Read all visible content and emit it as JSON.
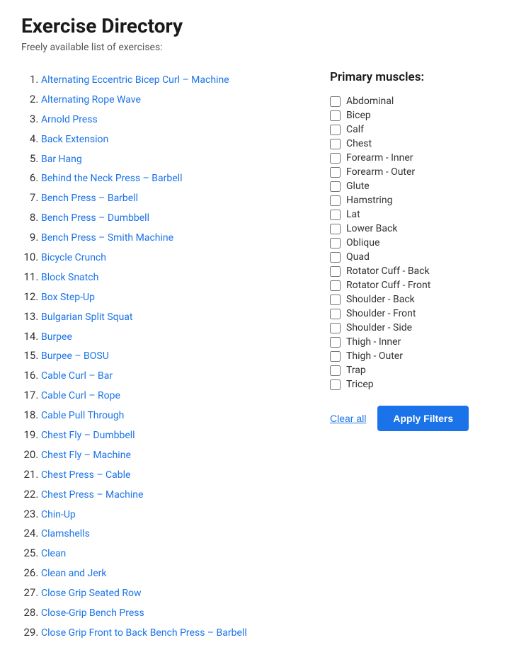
{
  "page": {
    "title": "Exercise Directory",
    "subtitle": "Freely available list of exercises:"
  },
  "exercises": [
    {
      "id": 1,
      "label": "Alternating Eccentric Bicep Curl – Machine"
    },
    {
      "id": 2,
      "label": "Alternating Rope Wave"
    },
    {
      "id": 3,
      "label": "Arnold Press"
    },
    {
      "id": 4,
      "label": "Back Extension"
    },
    {
      "id": 5,
      "label": "Bar Hang"
    },
    {
      "id": 6,
      "label": "Behind the Neck Press – Barbell"
    },
    {
      "id": 7,
      "label": "Bench Press – Barbell"
    },
    {
      "id": 8,
      "label": "Bench Press – Dumbbell"
    },
    {
      "id": 9,
      "label": "Bench Press – Smith Machine"
    },
    {
      "id": 10,
      "label": "Bicycle Crunch"
    },
    {
      "id": 11,
      "label": "Block Snatch"
    },
    {
      "id": 12,
      "label": "Box Step-Up"
    },
    {
      "id": 13,
      "label": "Bulgarian Split Squat"
    },
    {
      "id": 14,
      "label": "Burpee"
    },
    {
      "id": 15,
      "label": "Burpee – BOSU"
    },
    {
      "id": 16,
      "label": "Cable Curl – Bar"
    },
    {
      "id": 17,
      "label": "Cable Curl – Rope"
    },
    {
      "id": 18,
      "label": "Cable Pull Through"
    },
    {
      "id": 19,
      "label": "Chest Fly – Dumbbell"
    },
    {
      "id": 20,
      "label": "Chest Fly – Machine"
    },
    {
      "id": 21,
      "label": "Chest Press – Cable"
    },
    {
      "id": 22,
      "label": "Chest Press – Machine"
    },
    {
      "id": 23,
      "label": "Chin-Up"
    },
    {
      "id": 24,
      "label": "Clamshells"
    },
    {
      "id": 25,
      "label": "Clean"
    },
    {
      "id": 26,
      "label": "Clean and Jerk"
    },
    {
      "id": 27,
      "label": "Close Grip Seated Row"
    },
    {
      "id": 28,
      "label": "Close-Grip Bench Press"
    },
    {
      "id": 29,
      "label": "Close Grip Front to Back Bench Press – Barbell"
    }
  ],
  "filter_panel": {
    "heading": "Primary muscles:",
    "muscles": [
      {
        "label": "Abdominal",
        "checked": false
      },
      {
        "label": "Bicep",
        "checked": false
      },
      {
        "label": "Calf",
        "checked": false
      },
      {
        "label": "Chest",
        "checked": false
      },
      {
        "label": "Forearm - Inner",
        "checked": false
      },
      {
        "label": "Forearm - Outer",
        "checked": false
      },
      {
        "label": "Glute",
        "checked": false
      },
      {
        "label": "Hamstring",
        "checked": false
      },
      {
        "label": "Lat",
        "checked": false
      },
      {
        "label": "Lower Back",
        "checked": false
      },
      {
        "label": "Oblique",
        "checked": false
      },
      {
        "label": "Quad",
        "checked": false
      },
      {
        "label": "Rotator Cuff - Back",
        "checked": false
      },
      {
        "label": "Rotator Cuff - Front",
        "checked": false
      },
      {
        "label": "Shoulder - Back",
        "checked": false
      },
      {
        "label": "Shoulder - Front",
        "checked": false
      },
      {
        "label": "Shoulder - Side",
        "checked": false
      },
      {
        "label": "Thigh - Inner",
        "checked": false
      },
      {
        "label": "Thigh - Outer",
        "checked": false
      },
      {
        "label": "Trap",
        "checked": false
      },
      {
        "label": "Tricep",
        "checked": false
      }
    ],
    "clear_label": "Clear all",
    "apply_label": "Apply Filters"
  }
}
